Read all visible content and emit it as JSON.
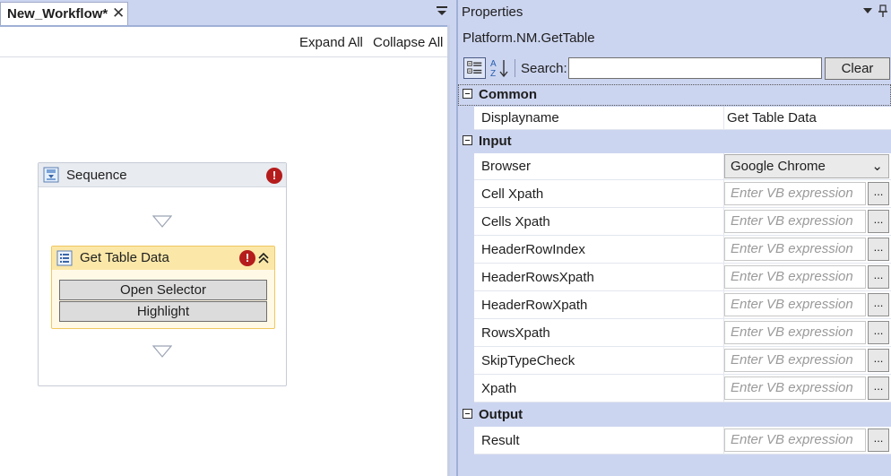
{
  "designer": {
    "tab_title": "New_Workflow*",
    "expand_all": "Expand All",
    "collapse_all": "Collapse All",
    "sequence": {
      "title": "Sequence",
      "activity": {
        "title": "Get Table Data",
        "buttons": [
          "Open Selector",
          "Highlight"
        ]
      }
    }
  },
  "properties": {
    "panel_title": "Properties",
    "activity_type": "Platform.NM.GetTable",
    "search_label": "Search:",
    "search_value": "",
    "clear_label": "Clear",
    "vb_placeholder": "Enter VB expression",
    "ellipsis": "...",
    "categories": {
      "common": {
        "label": "Common",
        "rows": [
          {
            "name": "Displayname",
            "value": "Get Table Data"
          }
        ]
      },
      "input": {
        "label": "Input",
        "rows": [
          {
            "name": "Browser",
            "value": "Google Chrome"
          },
          {
            "name": "Cell Xpath"
          },
          {
            "name": "Cells Xpath"
          },
          {
            "name": "HeaderRowIndex"
          },
          {
            "name": "HeaderRowsXpath"
          },
          {
            "name": "HeaderRowXpath"
          },
          {
            "name": "RowsXpath"
          },
          {
            "name": "SkipTypeCheck"
          },
          {
            "name": "Xpath"
          }
        ]
      },
      "output": {
        "label": "Output",
        "rows": [
          {
            "name": "Result"
          }
        ]
      }
    }
  },
  "icons": [
    "close-icon",
    "dropdown-menu-icon",
    "pin-icon",
    "sequence-icon",
    "error-icon",
    "activity-list-icon",
    "collapse-icon",
    "categorized-icon",
    "sort-az-icon",
    "chevron-down-icon"
  ],
  "colors": {
    "error": "#b51c1c",
    "activity_header": "#fbe7a8",
    "panel_bg": "#ccd5f0"
  }
}
